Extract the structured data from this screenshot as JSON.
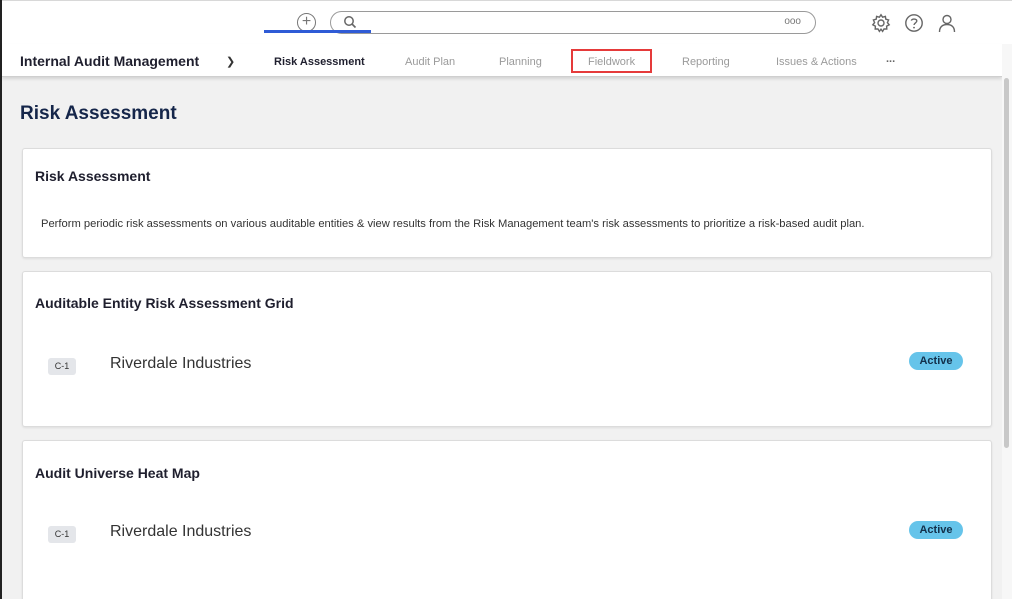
{
  "header": {
    "search": {
      "value": "",
      "placeholder": "",
      "options_label": "ooo"
    },
    "icons": [
      "add-icon",
      "search-icon",
      "settings-icon",
      "help-icon",
      "user-icon"
    ]
  },
  "nav": {
    "app_title": "Internal Audit Management",
    "tabs": [
      {
        "label": "Risk Assessment",
        "active": true
      },
      {
        "label": "Audit Plan"
      },
      {
        "label": "Planning"
      },
      {
        "label": "Fieldwork",
        "highlighted": true
      },
      {
        "label": "Reporting"
      },
      {
        "label": "Issues & Actions"
      },
      {
        "label": "..."
      }
    ]
  },
  "main": {
    "page_title": "Risk Assessment",
    "cards": [
      {
        "title": "Risk Assessment",
        "description": "Perform periodic risk assessments on various auditable entities & view results from the Risk Management team's risk assessments to prioritize a risk-based audit plan."
      },
      {
        "title": "Auditable Entity Risk Assessment Grid",
        "rows": [
          {
            "code": "C-1",
            "name": "Riverdale Industries",
            "status": "Active"
          }
        ]
      },
      {
        "title": "Audit Universe Heat Map",
        "rows": [
          {
            "code": "C-1",
            "name": "Riverdale Industries",
            "status": "Active"
          }
        ]
      }
    ]
  },
  "colors": {
    "accent": "#2f5bd6",
    "highlight": "#e53a3a",
    "status_active": "#66c4ea",
    "title_text": "#15264a"
  }
}
